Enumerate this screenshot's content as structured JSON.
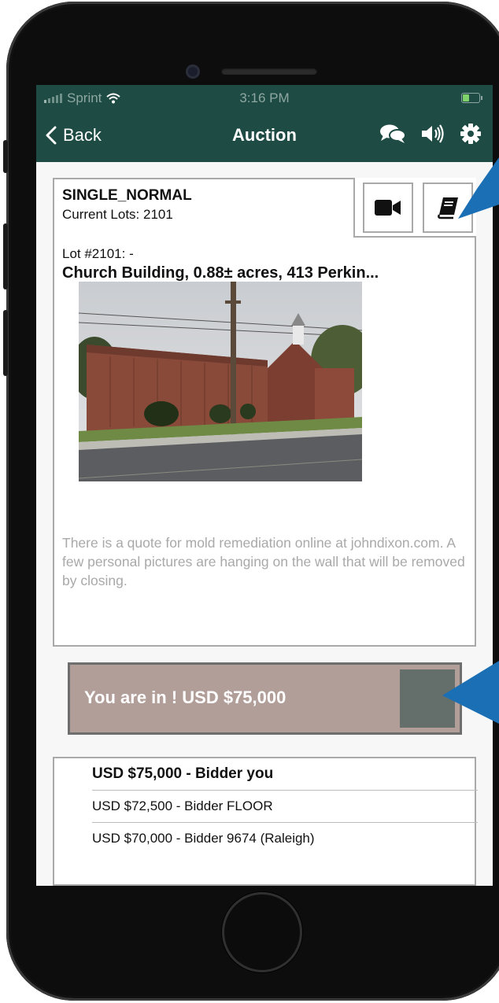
{
  "status_bar": {
    "carrier": "Sprint",
    "time": "3:16 PM",
    "battery_color": "#7fd36a"
  },
  "nav": {
    "back_label": "Back",
    "title": "Auction",
    "icons": [
      "chat-icon",
      "speaker-icon",
      "gear-icon"
    ],
    "background": "#1e4b44"
  },
  "lot": {
    "auction_name": "SINGLE_NORMAL",
    "current_lots": "Current Lots: 2101",
    "lot_number": "Lot #2101: -",
    "title": "Church Building, 0.88± acres, 413 Perkin...",
    "description": "There is a quote for mold remediation online at johndixon.com.  A few personal pictures are hanging on the wall that will be removed by closing.",
    "buttons": [
      "video-camera-icon",
      "book-icon"
    ]
  },
  "bid_button": {
    "label": "You are in ! USD $75,000",
    "background": "#b19e98",
    "indicator_color": "#646e6a"
  },
  "bid_history": [
    "USD $75,000 - Bidder you",
    "USD $72,500 - Bidder FLOOR",
    "USD $70,000 - Bidder 9674 (Raleigh)"
  ],
  "callout_color": "#1a6fb5"
}
